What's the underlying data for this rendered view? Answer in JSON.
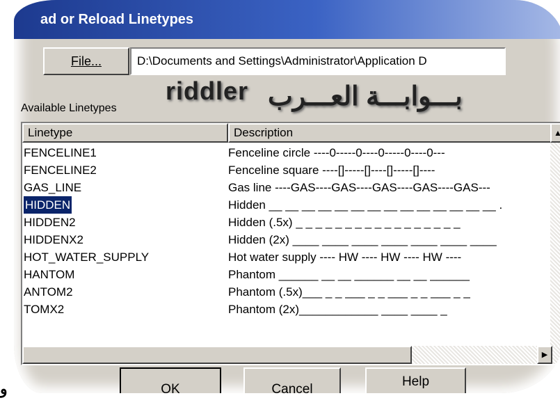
{
  "window": {
    "title": "ad or Reload Linetypes"
  },
  "file": {
    "button_label": "File...",
    "path_value": "D:\\Documents and Settings\\Administrator\\Application D"
  },
  "watermark": {
    "latin": "riddler",
    "arabic": "بـــوابـــة العـــرب"
  },
  "available_label": "Available Linetypes",
  "list": {
    "columns": [
      "Linetype",
      "Description"
    ],
    "rows": [
      {
        "linetype": "FENCELINE1",
        "description": "Fenceline circle ----0-----0----0-----0----0---",
        "selected": false
      },
      {
        "linetype": "FENCELINE2",
        "description": "Fenceline square ----[]-----[]----[]-----[]----",
        "selected": false
      },
      {
        "linetype": "GAS_LINE",
        "description": "Gas line ----GAS----GAS----GAS----GAS----GAS---",
        "selected": false
      },
      {
        "linetype": "HIDDEN",
        "description": "Hidden __ __ __ __ __ __ __ __ __ __ __ __ __ __ .",
        "selected": true
      },
      {
        "linetype": "HIDDEN2",
        "description": "Hidden (.5x) _ _ _ _ _ _ _ _ _ _ _ _ _ _ _ _ _",
        "selected": false
      },
      {
        "linetype": "HIDDENX2",
        "description": "Hidden (2x) ____ ____ ____ ____ ____ ____ ____",
        "selected": false
      },
      {
        "linetype": "HOT_WATER_SUPPLY",
        "description": "Hot water supply ---- HW ---- HW ---- HW ----",
        "selected": false
      },
      {
        "linetype": "HANTOM",
        "description": "Phantom ______ __ __ ______ __ __ ______",
        "selected": false
      },
      {
        "linetype": "ANTOM2",
        "description": "Phantom (.5x)___ _ _ ___ _ _ ___ _ _ ___ _ _",
        "selected": false
      },
      {
        "linetype": "TOMX2",
        "description": "Phantom (2x)____________ ____ ____ _",
        "selected": false
      }
    ]
  },
  "buttons": {
    "ok": "OK",
    "cancel": "Cancel",
    "help": "Help"
  },
  "corner_glyph": "و",
  "colors": {
    "title_bar": "#1d3a8f",
    "selection": "#0a246a",
    "face": "#d4d0c8"
  }
}
